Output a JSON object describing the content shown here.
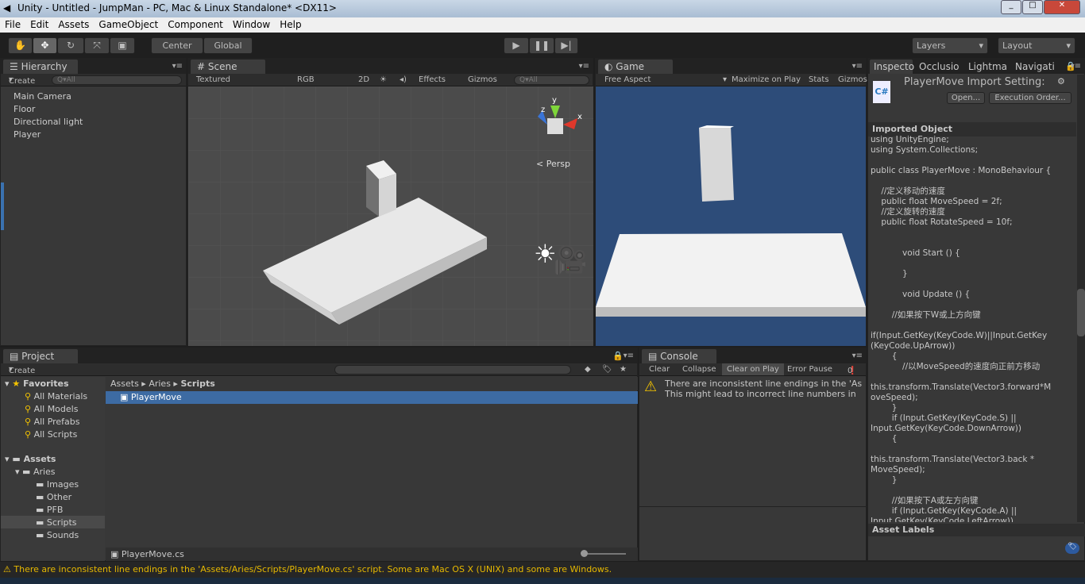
{
  "window": {
    "title": "Unity - Untitled - JumpMan - PC, Mac & Linux Standalone* <DX11>"
  },
  "menu": [
    "File",
    "Edit",
    "Assets",
    "GameObject",
    "Component",
    "Window",
    "Help"
  ],
  "toolbar": {
    "pivot": "Center",
    "space": "Global",
    "layers": "Layers",
    "layout": "Layout",
    "tools": [
      "hand-icon",
      "move-icon",
      "rotate-icon",
      "scale-icon",
      "rect-icon"
    ],
    "play": [
      "play-icon",
      "pause-icon",
      "step-icon"
    ]
  },
  "hierarchy": {
    "tab": "Hierarchy",
    "create": "Create",
    "search": "Q▾All",
    "items": [
      "Main Camera",
      "Floor",
      "Directional light",
      "Player"
    ]
  },
  "scene": {
    "tab": "Scene",
    "shading": "Textured",
    "render": "RGB",
    "mode2d": "2D",
    "effects": "Effects",
    "gizmos": "Gizmos",
    "search": "Q▾All",
    "persp": "Persp",
    "axes": {
      "x": "x",
      "y": "y",
      "z": "z"
    }
  },
  "game": {
    "tab": "Game",
    "aspect": "Free Aspect",
    "maximize": "Maximize on Play",
    "stats": "Stats",
    "gizmos": "Gizmos",
    "sky_color": "#2d4c79"
  },
  "inspector": {
    "tabs": [
      "Inspecto",
      "Occlusio",
      "Lightma",
      "Navigati"
    ],
    "title": "PlayerMove Import Setting:",
    "open": "Open...",
    "execution_order": "Execution Order...",
    "section": "Imported Object",
    "asset_labels": "Asset Labels",
    "code": [
      "using UnityEngine;",
      "using System.Collections;",
      "",
      "public class PlayerMove : MonoBehaviour {",
      "",
      "    //定义移动的速度",
      "    public float MoveSpeed = 2f;",
      "    //定义旋转的速度",
      "    public float RotateSpeed = 10f;",
      "",
      "",
      "            void Start () {",
      "",
      "            }",
      "",
      "            void Update () {",
      "",
      "        //如果按下W或上方向键",
      "",
      "if(Input.GetKey(KeyCode.W)||Input.GetKey",
      "(KeyCode.UpArrow))",
      "        {",
      "            //以MoveSpeed的速度向正前方移动",
      "",
      "this.transform.Translate(Vector3.forward*M",
      "oveSpeed);",
      "        }",
      "        if (Input.GetKey(KeyCode.S) ||",
      "Input.GetKey(KeyCode.DownArrow))",
      "        {",
      "",
      "this.transform.Translate(Vector3.back *",
      "MoveSpeed);",
      "        }",
      "",
      "        //如果按下A或左方向键",
      "        if (Input.GetKey(KeyCode.A) ||",
      "Input.GetKey(KeyCode.LeftArrow))"
    ]
  },
  "project": {
    "tab": "Project",
    "create": "Create",
    "favorites": "Favorites",
    "fav_items": [
      "All Materials",
      "All Models",
      "All Prefabs",
      "All Scripts"
    ],
    "assets": "Assets",
    "tree": [
      "Aries",
      "Images",
      "Other",
      "PFB",
      "Scripts",
      "Sounds"
    ],
    "breadcrumb": [
      "Assets",
      "Aries",
      "Scripts"
    ],
    "files": [
      "PlayerMove"
    ],
    "footer_file": "PlayerMove.cs"
  },
  "console": {
    "tab": "Console",
    "buttons": [
      "Clear",
      "Collapse",
      "Clear on Play",
      "Error Pause"
    ],
    "count": "0",
    "message_line1": "There are inconsistent line endings in the 'As",
    "message_line2": "This might lead to incorrect line numbers in"
  },
  "status": {
    "message": "There are inconsistent line endings in the 'Assets/Aries/Scripts/PlayerMove.cs' script. Some are Mac OS X (UNIX) and some are Windows.",
    "color": "#e6b800"
  }
}
